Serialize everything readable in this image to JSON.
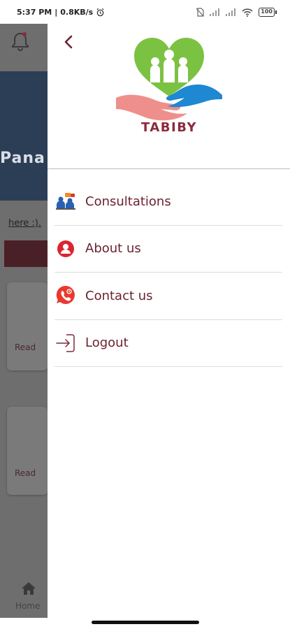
{
  "status_bar": {
    "time": "5:37 PM",
    "speed": "0.8KB/s",
    "battery": "100"
  },
  "background_app": {
    "banner_text": "Pana",
    "link_text": "here :).",
    "card_read_1": "Read",
    "card_read_2": "Read",
    "home_label": "Home"
  },
  "drawer": {
    "logo_text": "TABIBY",
    "menu": [
      {
        "label": "Consultations",
        "icon": "consultations-icon"
      },
      {
        "label": "About us",
        "icon": "person-icon"
      },
      {
        "label": "Contact us",
        "icon": "phone-icon"
      },
      {
        "label": "Logout",
        "icon": "logout-icon"
      }
    ]
  },
  "colors": {
    "accent": "#6a2230",
    "logo_heart": "#7cc242",
    "logo_hand_left": "#ef8f8b",
    "logo_hand_right": "#1e88d2"
  }
}
